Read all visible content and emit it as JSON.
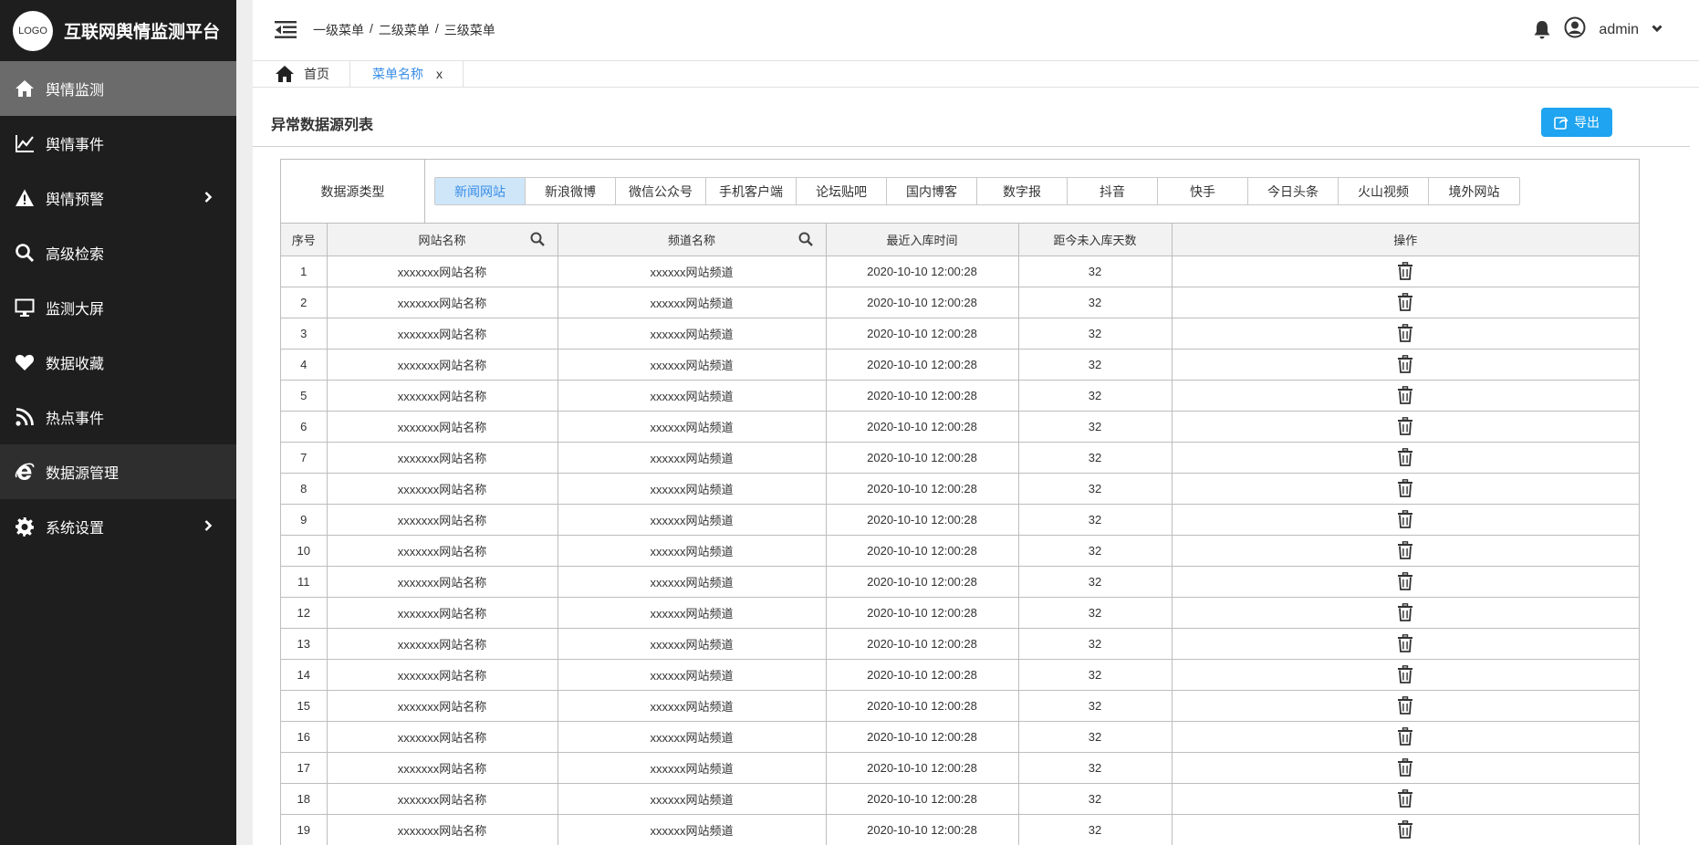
{
  "brand": {
    "logo_text": "LOGO",
    "title": "互联网舆情监测平台"
  },
  "sidebar": {
    "items": [
      {
        "label": "舆情监测",
        "icon": "home-icon",
        "state": "active",
        "has_children": false
      },
      {
        "label": "舆情事件",
        "icon": "line-chart-icon",
        "state": "",
        "has_children": false
      },
      {
        "label": "舆情预警",
        "icon": "warning-icon",
        "state": "",
        "has_children": true
      },
      {
        "label": "高级检索",
        "icon": "search-icon",
        "state": "",
        "has_children": false
      },
      {
        "label": "监测大屏",
        "icon": "monitor-icon",
        "state": "",
        "has_children": false
      },
      {
        "label": "数据收藏",
        "icon": "heart-icon",
        "state": "",
        "has_children": false
      },
      {
        "label": "热点事件",
        "icon": "rss-icon",
        "state": "",
        "has_children": false
      },
      {
        "label": "数据源管理",
        "icon": "ie-icon",
        "state": "current",
        "has_children": false
      },
      {
        "label": "系统设置",
        "icon": "gear-icon",
        "state": "",
        "has_children": true
      }
    ]
  },
  "header": {
    "breadcrumb": [
      "一级菜单",
      "二级菜单",
      "三级菜单"
    ],
    "breadcrumb_sep": "/",
    "user_name": "admin"
  },
  "tabs": [
    {
      "label": "首页",
      "icon": "home-icon",
      "active": false,
      "closable": false
    },
    {
      "label": "菜单名称",
      "active": true,
      "closable": true,
      "close_label": "x"
    }
  ],
  "page": {
    "title": "异常数据源列表",
    "export_label": "导出"
  },
  "filter": {
    "label": "数据源类型",
    "options": [
      "新闻网站",
      "新浪微博",
      "微信公众号",
      "手机客户端",
      "论坛贴吧",
      "国内博客",
      "数字报",
      "抖音",
      "快手",
      "今日头条",
      "火山视频",
      "境外网站"
    ],
    "selected_index": 0
  },
  "table": {
    "columns": [
      "序号",
      "网站名称",
      "频道名称",
      "最近入库时间",
      "距今未入库天数",
      "操作"
    ],
    "rows": [
      [
        "1",
        "xxxxxxx网站名称",
        "xxxxxx网站频道",
        "2020-10-10 12:00:28",
        "32"
      ],
      [
        "2",
        "xxxxxxx网站名称",
        "xxxxxx网站频道",
        "2020-10-10 12:00:28",
        "32"
      ],
      [
        "3",
        "xxxxxxx网站名称",
        "xxxxxx网站频道",
        "2020-10-10 12:00:28",
        "32"
      ],
      [
        "4",
        "xxxxxxx网站名称",
        "xxxxxx网站频道",
        "2020-10-10 12:00:28",
        "32"
      ],
      [
        "5",
        "xxxxxxx网站名称",
        "xxxxxx网站频道",
        "2020-10-10 12:00:28",
        "32"
      ],
      [
        "6",
        "xxxxxxx网站名称",
        "xxxxxx网站频道",
        "2020-10-10 12:00:28",
        "32"
      ],
      [
        "7",
        "xxxxxxx网站名称",
        "xxxxxx网站频道",
        "2020-10-10 12:00:28",
        "32"
      ],
      [
        "8",
        "xxxxxxx网站名称",
        "xxxxxx网站频道",
        "2020-10-10 12:00:28",
        "32"
      ],
      [
        "9",
        "xxxxxxx网站名称",
        "xxxxxx网站频道",
        "2020-10-10 12:00:28",
        "32"
      ],
      [
        "10",
        "xxxxxxx网站名称",
        "xxxxxx网站频道",
        "2020-10-10 12:00:28",
        "32"
      ],
      [
        "11",
        "xxxxxxx网站名称",
        "xxxxxx网站频道",
        "2020-10-10 12:00:28",
        "32"
      ],
      [
        "12",
        "xxxxxxx网站名称",
        "xxxxxx网站频道",
        "2020-10-10 12:00:28",
        "32"
      ],
      [
        "13",
        "xxxxxxx网站名称",
        "xxxxxx网站频道",
        "2020-10-10 12:00:28",
        "32"
      ],
      [
        "14",
        "xxxxxxx网站名称",
        "xxxxxx网站频道",
        "2020-10-10 12:00:28",
        "32"
      ],
      [
        "15",
        "xxxxxxx网站名称",
        "xxxxxx网站频道",
        "2020-10-10 12:00:28",
        "32"
      ],
      [
        "16",
        "xxxxxxx网站名称",
        "xxxxxx网站频道",
        "2020-10-10 12:00:28",
        "32"
      ],
      [
        "17",
        "xxxxxxx网站名称",
        "xxxxxx网站频道",
        "2020-10-10 12:00:28",
        "32"
      ],
      [
        "18",
        "xxxxxxx网站名称",
        "xxxxxx网站频道",
        "2020-10-10 12:00:28",
        "32"
      ],
      [
        "19",
        "xxxxxxx网站名称",
        "xxxxxx网站频道",
        "2020-10-10 12:00:28",
        "32"
      ]
    ],
    "action_icon": "trash-icon"
  },
  "colors": {
    "sidebar_bg": "#1e1e1e",
    "sidebar_active": "#6b6b6b",
    "accent": "#3a8ee6",
    "export_button": "#1ea4f0",
    "selected_filter_bg": "#cfe6f9"
  }
}
